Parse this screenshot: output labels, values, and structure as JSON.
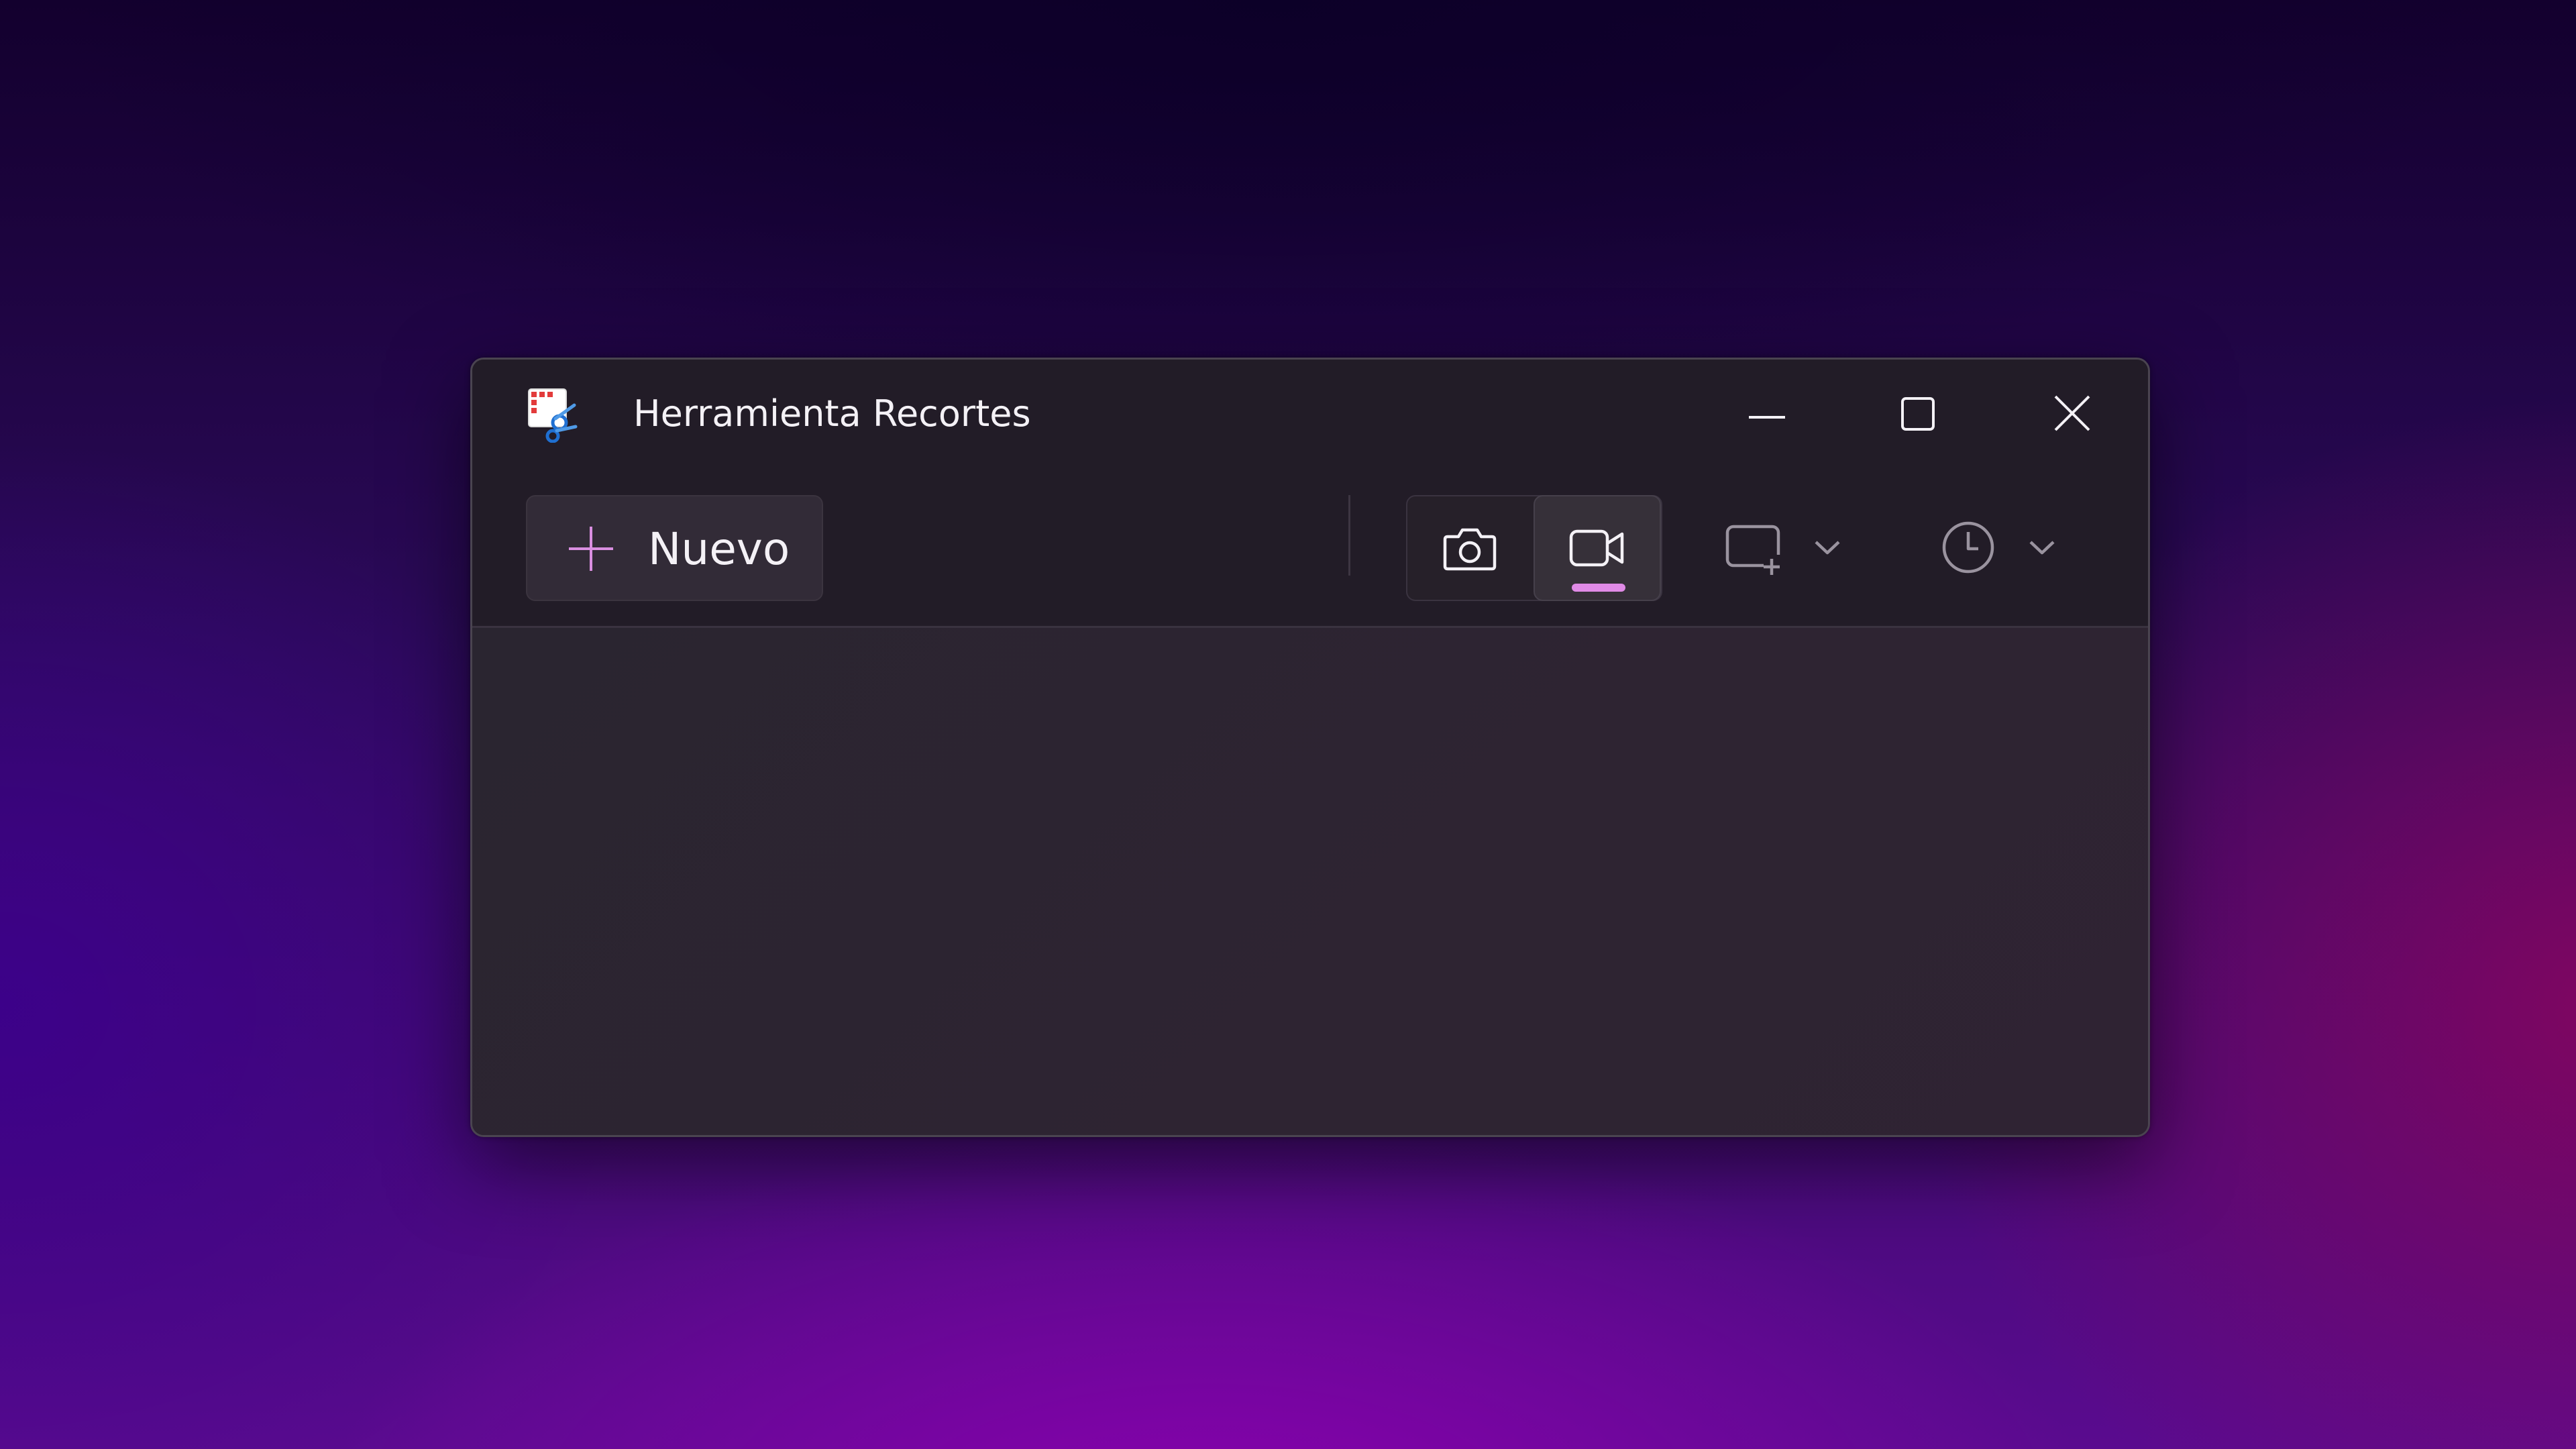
{
  "window": {
    "title": "Herramienta Recortes"
  },
  "toolbar": {
    "new_label": "Nuevo"
  },
  "icons": {
    "app": "snipping-tool-icon",
    "minimize": "minimize-icon",
    "maximize": "maximize-icon",
    "close": "close-icon",
    "new": "plus-icon",
    "photo_mode": "camera-icon",
    "video_mode": "video-camera-icon",
    "shape": "rectangle-selection-icon",
    "shape_dropdown": "chevron-down-icon",
    "timer": "clock-icon",
    "timer_dropdown": "chevron-down-icon",
    "more": "more-options-icon"
  },
  "state": {
    "selected_mode": "video"
  },
  "colors": {
    "accent": "#e08ae6",
    "window_bg": "#221c27",
    "content_bg": "#2b2430",
    "text": "#f4f1f6",
    "icon_muted": "#9a939f"
  }
}
